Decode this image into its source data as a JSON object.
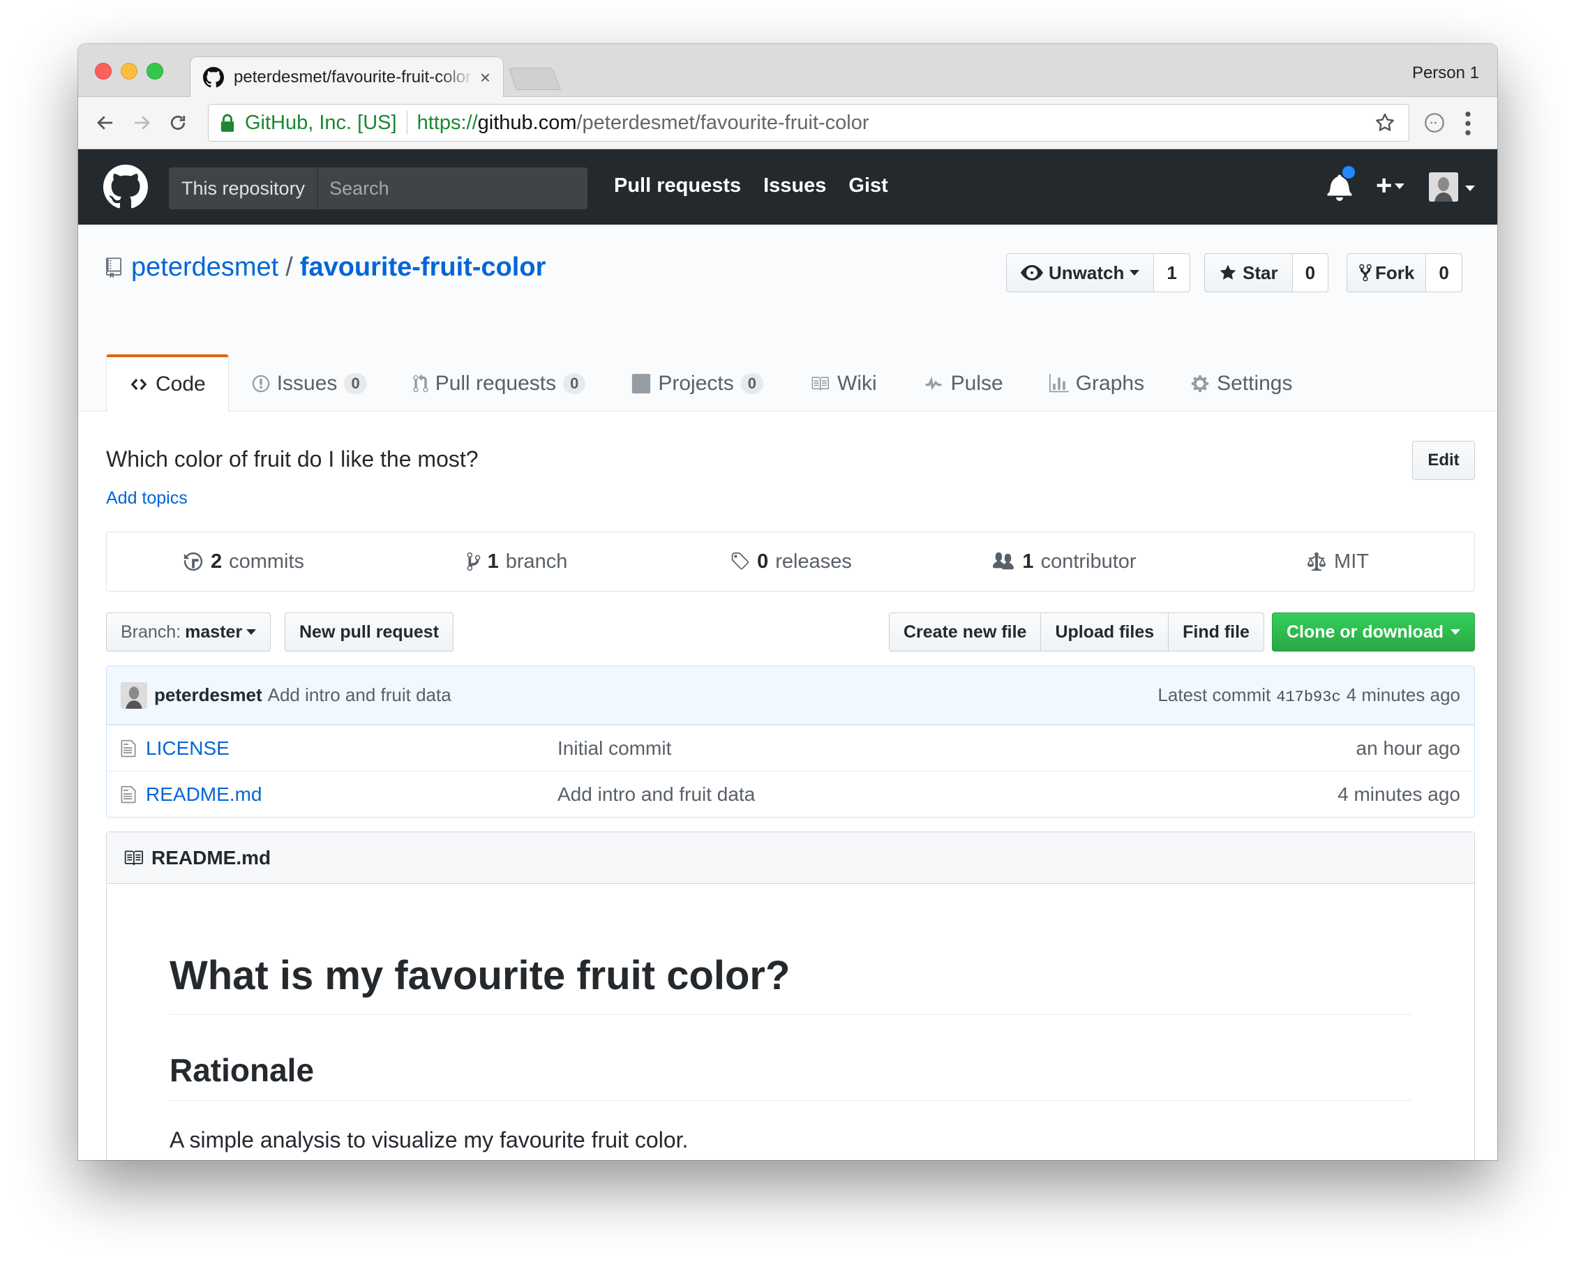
{
  "browser": {
    "tab_title": "peterdesmet/favourite-fruit-color",
    "profile_name": "Person 1",
    "ev_name": "GitHub, Inc. [US]",
    "url_scheme": "https://",
    "url_host": "github.com",
    "url_path": "/peterdesmet/favourite-fruit-color"
  },
  "gh_header": {
    "scope_label": "This repository",
    "search_placeholder": "Search",
    "nav": [
      "Pull requests",
      "Issues",
      "Gist"
    ],
    "plus_label": "+",
    "notification_dot_color": "#2188ff"
  },
  "repo": {
    "owner": "peterdesmet",
    "separator": "/",
    "name": "favourite-fruit-color",
    "watch": {
      "label": "Unwatch",
      "count": "1"
    },
    "star": {
      "label": "Star",
      "count": "0"
    },
    "fork": {
      "label": "Fork",
      "count": "0"
    }
  },
  "reponav": {
    "code": "Code",
    "issues": {
      "label": "Issues",
      "count": "0"
    },
    "pulls": {
      "label": "Pull requests",
      "count": "0"
    },
    "projects": {
      "label": "Projects",
      "count": "0"
    },
    "wiki": "Wiki",
    "pulse": "Pulse",
    "graphs": "Graphs",
    "settings": "Settings",
    "selected_accent": "#e36209"
  },
  "summary": {
    "description": "Which color of fruit do I like the most?",
    "add_topics": "Add topics",
    "edit_label": "Edit"
  },
  "numbers": {
    "commits": {
      "count": "2",
      "label": "commits"
    },
    "branch": {
      "count": "1",
      "label": "branch"
    },
    "releases": {
      "count": "0",
      "label": "releases"
    },
    "contributor": {
      "count": "1",
      "label": "contributor"
    },
    "license": "MIT"
  },
  "file_nav": {
    "branch_prefix": "Branch:",
    "branch_name": "master",
    "new_pr": "New pull request",
    "create_file": "Create new file",
    "upload_files": "Upload files",
    "find_file": "Find file",
    "clone": "Clone or download",
    "clone_color": "#28a745"
  },
  "commit_tease": {
    "author": "peterdesmet",
    "message": "Add intro and fruit data",
    "latest_label": "Latest commit",
    "sha": "417b93c",
    "age": "4 minutes ago"
  },
  "files": [
    {
      "name": "LICENSE",
      "message": "Initial commit",
      "age": "an hour ago"
    },
    {
      "name": "README.md",
      "message": "Add intro and fruit data",
      "age": "4 minutes ago"
    }
  ],
  "readme": {
    "header": "README.md",
    "h1": "What is my favourite fruit color?",
    "h2": "Rationale",
    "paragraph": "A simple analysis to visualize my favourite fruit color."
  }
}
